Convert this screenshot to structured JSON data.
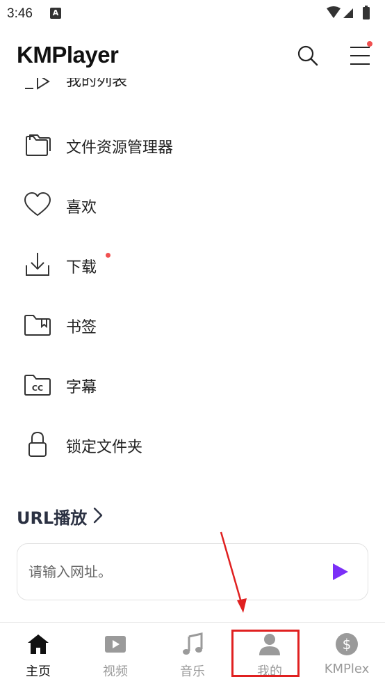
{
  "status_bar": {
    "time": "3:46",
    "notification_icon": "a-box-icon"
  },
  "header": {
    "logo": "KMPlayer",
    "menu_has_badge": true
  },
  "list": {
    "partial_label": "我的列表",
    "items": [
      {
        "label": "文件资源管理器",
        "icon": "folder-icon"
      },
      {
        "label": "喜欢",
        "icon": "heart-icon"
      },
      {
        "label": "下载",
        "icon": "download-icon",
        "badge": true
      },
      {
        "label": "书签",
        "icon": "bookmark-folder-icon"
      },
      {
        "label": "字幕",
        "icon": "subtitle-cc-icon"
      },
      {
        "label": "锁定文件夹",
        "icon": "lock-icon"
      }
    ]
  },
  "url_section": {
    "title": "URL播放",
    "placeholder": "请输入网址。"
  },
  "bottom_nav": {
    "items": [
      {
        "label": "主页",
        "icon": "home-icon",
        "active": true
      },
      {
        "label": "视频",
        "icon": "video-icon"
      },
      {
        "label": "音乐",
        "icon": "music-note-icon"
      },
      {
        "label": "我的",
        "icon": "user-icon"
      },
      {
        "label": "KMPlex",
        "icon": "dollar-coin-icon"
      }
    ]
  },
  "colors": {
    "accent": "#7b2ff7",
    "badge": "#f05050",
    "annotation": "#e02020"
  }
}
